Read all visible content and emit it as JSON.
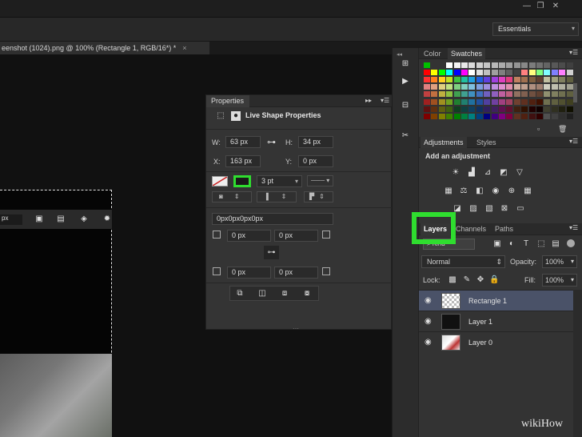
{
  "window": {
    "minimize": "—",
    "restore": "❐",
    "close": "✕"
  },
  "workspace": {
    "selected": "Essentials"
  },
  "document_tab": {
    "title": "eenshot (1024).png @ 100% (Rectangle 1, RGB/16*) *",
    "close": "×"
  },
  "options_bar": {
    "value_fragment": "px"
  },
  "properties": {
    "tab": "Properties",
    "title": "Live Shape Properties",
    "w_label": "W:",
    "w_value": "63 px",
    "h_label": "H:",
    "h_value": "34 px",
    "x_label": "X:",
    "x_value": "163 px",
    "y_label": "Y:",
    "y_value": "0 px",
    "stroke_width": "3 pt",
    "radius_summary": "0px0px0px0px",
    "radii": [
      "0 px",
      "0 px",
      "0 px",
      "0 px"
    ]
  },
  "panels": {
    "color_tab": "Color",
    "swatches_tab": "Swatches",
    "adjustments_tab": "Adjustments",
    "styles_tab": "Styles",
    "add_adjustment": "Add an adjustment",
    "layers_tab": "Layers",
    "channels_tab": "Channels",
    "paths_tab": "Paths",
    "kind_filter": "Kind",
    "blend_mode": "Normal",
    "opacity_label": "Opacity:",
    "opacity_value": "100%",
    "lock_label": "Lock:",
    "fill_label": "Fill:",
    "fill_value": "100%",
    "layers": [
      {
        "name": "Rectangle 1"
      },
      {
        "name": "Layer 1"
      },
      {
        "name": "Layer 0"
      }
    ]
  },
  "watermark": "wikiHow",
  "colors": {
    "highlight": "#2fdd2f",
    "panel": "#333333",
    "canvas": "#111111",
    "selected_layer": "#4a5268"
  }
}
